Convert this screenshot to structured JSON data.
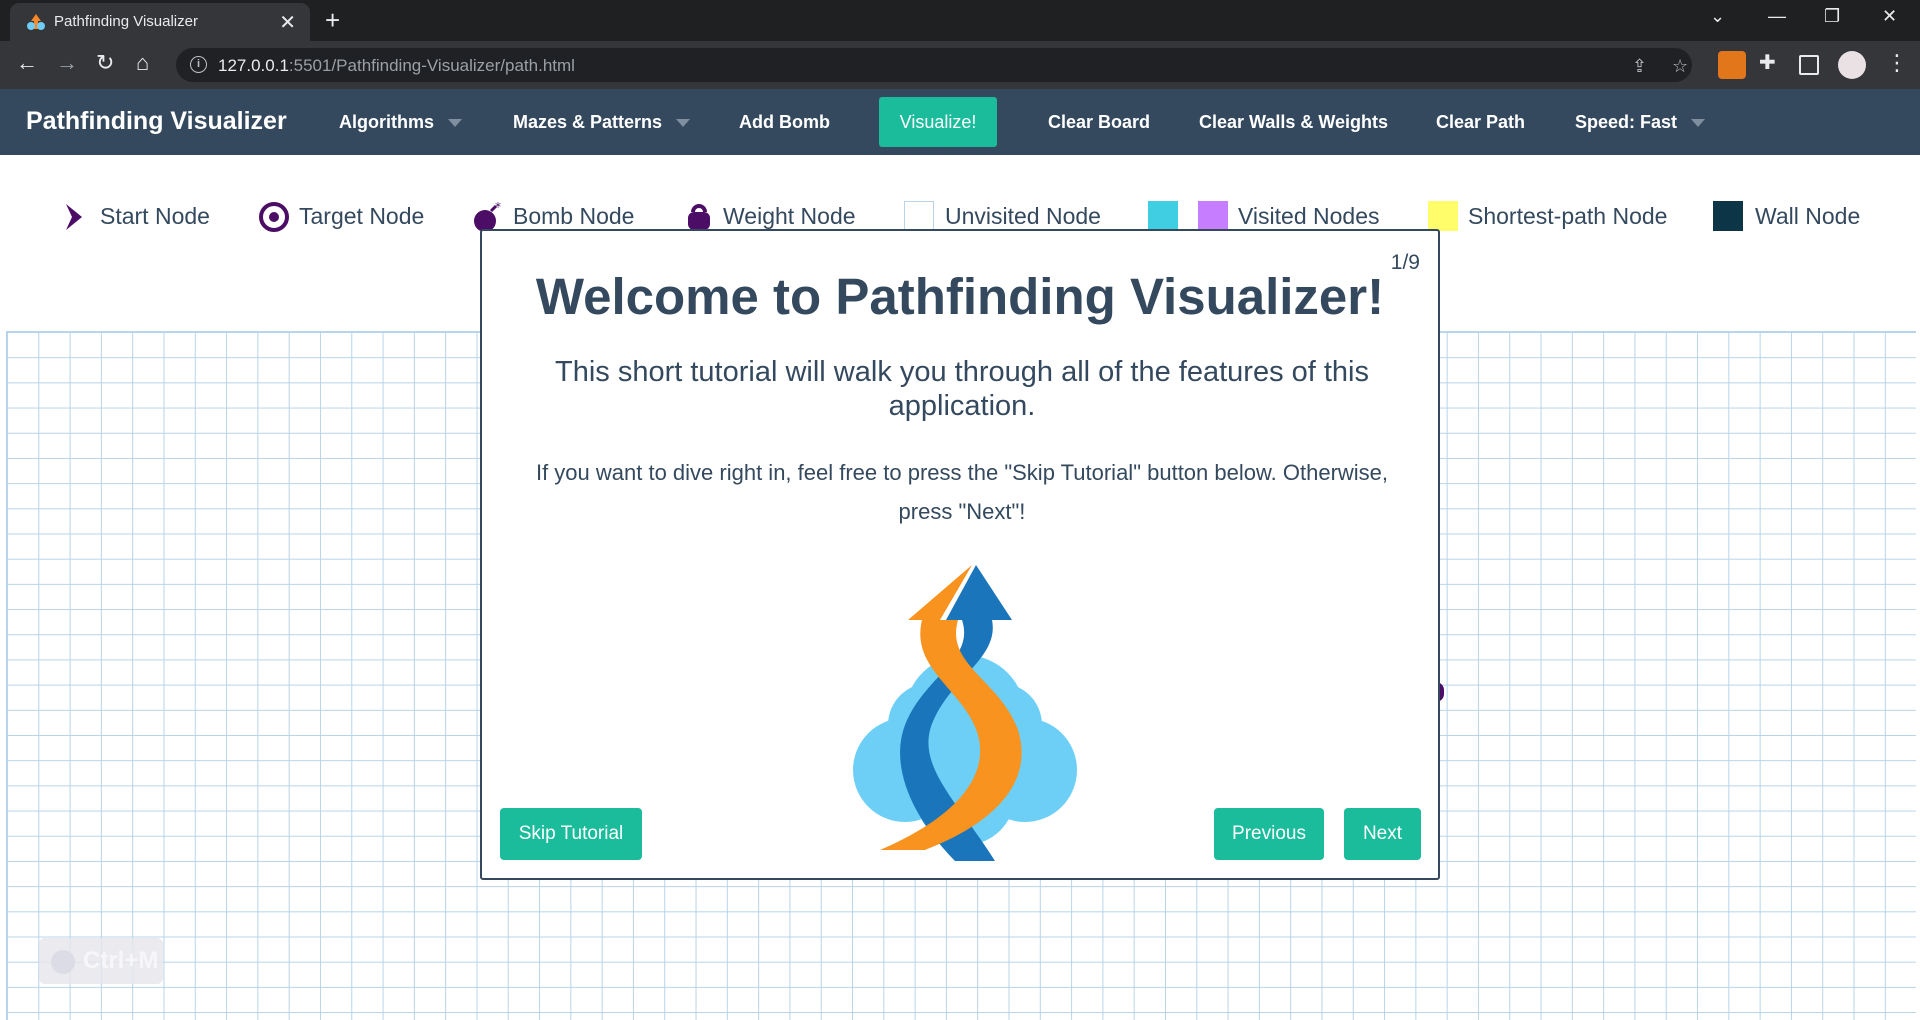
{
  "browser": {
    "tab_title": "Pathfinding Visualizer",
    "url_host": "127.0.0.1",
    "url_rest": ":5501/Pathfinding-Visualizer/path.html"
  },
  "nav": {
    "brand": "Pathfinding Visualizer",
    "algorithms": "Algorithms",
    "mazes": "Mazes & Patterns",
    "add_bomb": "Add Bomb",
    "visualize": "Visualize!",
    "clear_board": "Clear Board",
    "clear_walls": "Clear Walls & Weights",
    "clear_path": "Clear Path",
    "speed": "Speed: Fast"
  },
  "legend": {
    "start": "Start Node",
    "target": "Target Node",
    "bomb": "Bomb Node",
    "weight": "Weight Node",
    "unvisited": "Unvisited Node",
    "visited": "Visited Nodes",
    "shortest": "Shortest-path Node",
    "wall": "Wall Node"
  },
  "colors": {
    "accent": "#1abc9c",
    "navbar": "#34495e",
    "node_purple": "#4b0d65",
    "visited_cyan": "#40cee3",
    "visited_purple": "#c77dff",
    "shortest_yellow": "#fffe6a",
    "wall": "#0c3547"
  },
  "modal": {
    "counter": "1/9",
    "title": "Welcome to Pathfinding Visualizer!",
    "subtitle": "This short tutorial will walk you through all of the features of this application.",
    "text": "If you want to dive right in, feel free to press the \"Skip Tutorial\" button below. Otherwise, press \"Next\"!",
    "skip": "Skip Tutorial",
    "previous": "Previous",
    "next": "Next"
  },
  "shortcut_hint": "Ctrl+M"
}
